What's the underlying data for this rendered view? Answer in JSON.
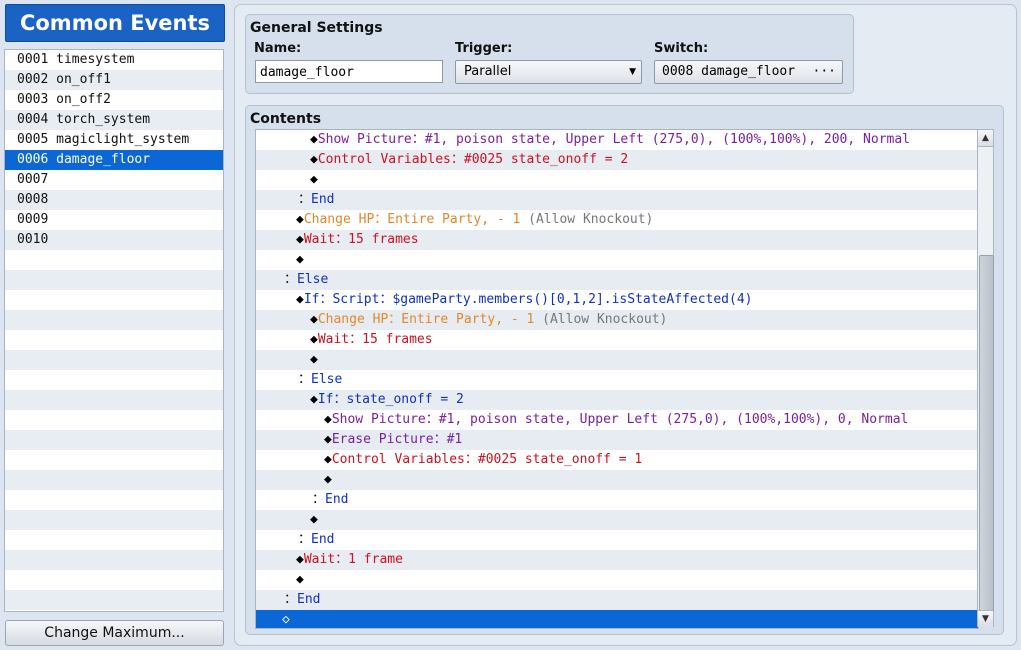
{
  "left_panel": {
    "title": "Common Events",
    "events": [
      {
        "id": "0001",
        "name": "timesystem"
      },
      {
        "id": "0002",
        "name": "on_off1"
      },
      {
        "id": "0003",
        "name": "on_off2"
      },
      {
        "id": "0004",
        "name": "torch_system"
      },
      {
        "id": "0005",
        "name": "magiclight_system"
      },
      {
        "id": "0006",
        "name": "damage_floor",
        "selected": true
      },
      {
        "id": "0007",
        "name": ""
      },
      {
        "id": "0008",
        "name": ""
      },
      {
        "id": "0009",
        "name": ""
      },
      {
        "id": "0010",
        "name": ""
      }
    ],
    "change_max_label": "Change Maximum..."
  },
  "general_settings": {
    "title": "General Settings",
    "name_label": "Name:",
    "name_value": "damage_floor",
    "trigger_label": "Trigger:",
    "trigger_value": "Parallel",
    "switch_label": "Switch:",
    "switch_value": "0008 damage_floor",
    "switch_button": "···"
  },
  "contents": {
    "title": "Contents",
    "commands": [
      {
        "indent": 3,
        "segs": [
          {
            "t": "Show Picture：#1, poison state, Upper Left (275,0), (100%,100%), 200, Normal",
            "c": "purple"
          }
        ]
      },
      {
        "indent": 3,
        "segs": [
          {
            "t": "Control Variables：#0025 state_onoff = 2",
            "c": "red"
          }
        ]
      },
      {
        "indent": 3,
        "segs": []
      },
      {
        "indent": 2,
        "colon": true,
        "segs": [
          {
            "t": "End",
            "c": "blue"
          }
        ]
      },
      {
        "indent": 2,
        "segs": [
          {
            "t": "Change HP：Entire Party, - 1 ",
            "c": "orange"
          },
          {
            "t": "(Allow Knockout)",
            "c": "gray"
          }
        ]
      },
      {
        "indent": 2,
        "segs": [
          {
            "t": "Wait：15 frames",
            "c": "red"
          }
        ]
      },
      {
        "indent": 2,
        "segs": []
      },
      {
        "indent": 1,
        "colon": true,
        "segs": [
          {
            "t": "Else",
            "c": "blue"
          }
        ]
      },
      {
        "indent": 2,
        "segs": [
          {
            "t": "If：Script：",
            "c": "blue"
          },
          {
            "t": "$gameParty.members()[0,1,2].isStateAffected(4)",
            "c": "blue"
          }
        ]
      },
      {
        "indent": 3,
        "segs": [
          {
            "t": "Change HP：Entire Party, - 1 ",
            "c": "orange"
          },
          {
            "t": "(Allow Knockout)",
            "c": "gray"
          }
        ]
      },
      {
        "indent": 3,
        "segs": [
          {
            "t": "Wait：15 frames",
            "c": "red"
          }
        ]
      },
      {
        "indent": 3,
        "segs": []
      },
      {
        "indent": 2,
        "colon": true,
        "segs": [
          {
            "t": "Else",
            "c": "blue"
          }
        ]
      },
      {
        "indent": 3,
        "segs": [
          {
            "t": "If：state_onoff = 2",
            "c": "blue"
          }
        ]
      },
      {
        "indent": 4,
        "segs": [
          {
            "t": "Show Picture：#1, poison state, Upper Left (275,0), (100%,100%), 0, Normal",
            "c": "purple"
          }
        ]
      },
      {
        "indent": 4,
        "segs": [
          {
            "t": "Erase Picture：#1",
            "c": "purple"
          }
        ]
      },
      {
        "indent": 4,
        "segs": [
          {
            "t": "Control Variables：#0025 state_onoff = 1",
            "c": "red"
          }
        ]
      },
      {
        "indent": 4,
        "segs": []
      },
      {
        "indent": 3,
        "colon": true,
        "segs": [
          {
            "t": "End",
            "c": "blue"
          }
        ]
      },
      {
        "indent": 3,
        "segs": []
      },
      {
        "indent": 2,
        "colon": true,
        "segs": [
          {
            "t": "End",
            "c": "blue"
          }
        ]
      },
      {
        "indent": 2,
        "segs": [
          {
            "t": "Wait：1 frame",
            "c": "red"
          }
        ]
      },
      {
        "indent": 2,
        "segs": []
      },
      {
        "indent": 1,
        "colon": true,
        "segs": [
          {
            "t": "End",
            "c": "blue"
          }
        ]
      },
      {
        "indent": 1,
        "selected": true,
        "segs": []
      }
    ]
  },
  "icons": {
    "diamond": "diamond-icon",
    "dropdown": "chevron-down-icon",
    "scroll_up": "arrow-up-icon",
    "scroll_down": "arrow-down-icon"
  },
  "colors": {
    "header_blue": "#1a62c4",
    "selection_blue": "#0b66d6",
    "purple": "#7a1fa2",
    "red": "#d01020",
    "orange": "#e0882a",
    "blue": "#1030c0",
    "gray": "#777777"
  }
}
